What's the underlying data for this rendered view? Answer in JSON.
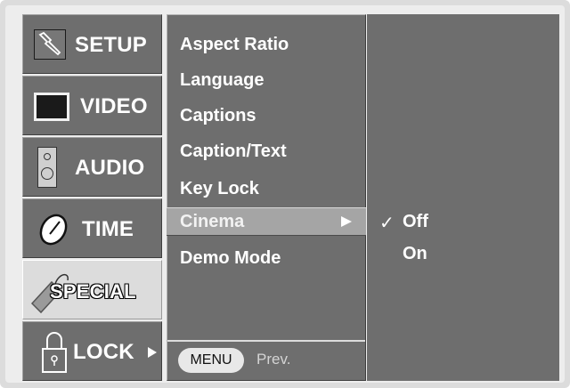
{
  "categories": [
    {
      "label": "SETUP",
      "icon": "wrench-icon"
    },
    {
      "label": "VIDEO",
      "icon": "screen-icon"
    },
    {
      "label": "AUDIO",
      "icon": "speaker-icon"
    },
    {
      "label": "TIME",
      "icon": "clock-icon"
    },
    {
      "label": "SPECIAL",
      "icon": "tag-icon"
    },
    {
      "label": "LOCK",
      "icon": "padlock-icon"
    }
  ],
  "selected_category": "SPECIAL",
  "menu": {
    "items": [
      "Aspect Ratio",
      "Language",
      "Captions",
      "Caption/Text",
      "Key Lock",
      "Cinema",
      "Demo Mode"
    ],
    "highlighted": "Cinema",
    "footer": {
      "button": "MENU",
      "label": "Prev."
    }
  },
  "submenu": {
    "options": [
      "Off",
      "On"
    ],
    "checked": "Off",
    "check_mark": "✓"
  },
  "colors": {
    "panel": "#6e6e6e",
    "highlight": "#a5a5a5",
    "frame": "#dcdcdc"
  }
}
